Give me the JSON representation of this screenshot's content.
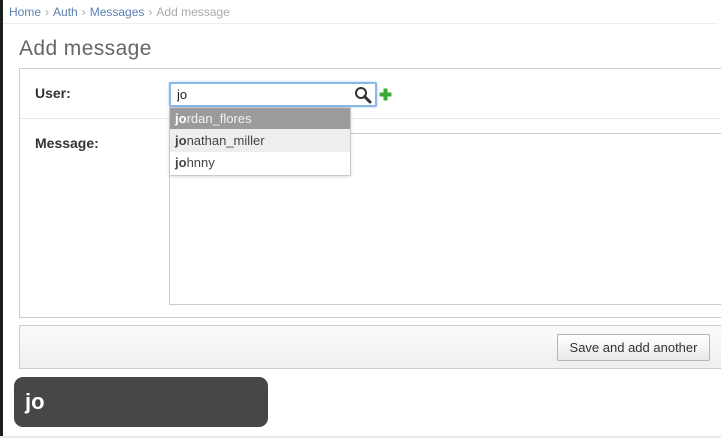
{
  "breadcrumb": {
    "home": "Home",
    "auth": "Auth",
    "messages": "Messages",
    "current": "Add message",
    "separator": "›"
  },
  "page_title": "Add message",
  "form": {
    "user_label": "User:",
    "user_value": "jo",
    "message_label": "Message:",
    "message_value": ""
  },
  "autocomplete": {
    "items": [
      {
        "match": "jo",
        "rest": "rdan_flores",
        "state": "active"
      },
      {
        "match": "jo",
        "rest": "nathan_miller",
        "state": "hover"
      },
      {
        "match": "jo",
        "rest": "hnny",
        "state": "normal"
      }
    ]
  },
  "submit": {
    "save_add_another_label": "Save and add another"
  },
  "typed_overlay": {
    "text": "jo"
  },
  "icons": {
    "search": "search-icon",
    "add": "add-icon"
  },
  "colors": {
    "link": "#5b80b2",
    "focus_border": "#8ab8e8",
    "active_suggestion": "#9b9b9b",
    "add_icon_green": "#3aa936",
    "overlay_bg": "#474747"
  }
}
